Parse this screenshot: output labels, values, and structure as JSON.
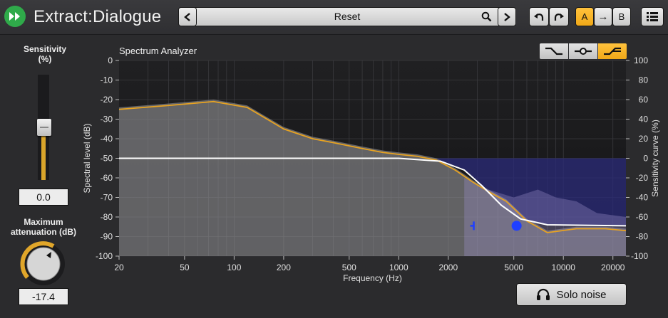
{
  "app": {
    "title": "Extract:Dialogue"
  },
  "preset": {
    "name": "Reset"
  },
  "ab": {
    "a_label": "A",
    "b_label": "B",
    "arrow": "→",
    "active": "A"
  },
  "sensitivity": {
    "label": "Sensitivity\n(%)",
    "value": "0.0",
    "level": 0.0
  },
  "attenuation": {
    "label": "Maximum\nattenuation (dB)",
    "value": "-17.4"
  },
  "analyzer": {
    "title": "Spectrum Analyzer"
  },
  "solo": {
    "label": "Solo noise"
  },
  "colors": {
    "accent": "#f0a818",
    "spectrum": "#e8a321",
    "curve": "#ffffff",
    "noise_region": "#2b2b7a",
    "handle": "#1f3fff"
  },
  "icons": {
    "logo": "fast-forward-icon",
    "preset_prev": "chevron-left-icon",
    "preset_search": "search-icon",
    "preset_next": "chevron-right-icon",
    "undo": "undo-icon",
    "redo": "redo-icon",
    "menu": "list-menu-icon",
    "headphones": "headphones-icon"
  },
  "chart_data": {
    "type": "line",
    "xlabel": "Frequency (Hz)",
    "ylabel": "Spectral level (dB)",
    "y2label": "Sensitivity curve (%)",
    "x_scale": "log",
    "xlim": [
      20,
      24000
    ],
    "ylim": [
      -100,
      0
    ],
    "y2lim": [
      -100,
      100
    ],
    "x_ticks": [
      "20",
      "50",
      "100",
      "200",
      "500",
      "1000",
      "2000",
      "5000",
      "10000",
      "20000"
    ],
    "y_ticks": [
      "0",
      "-10",
      "-20",
      "-30",
      "-40",
      "-50",
      "-60",
      "-70",
      "-80",
      "-90",
      "-100"
    ],
    "y2_ticks": [
      "100",
      "80",
      "60",
      "40",
      "20",
      "0",
      "-20",
      "-40",
      "-60",
      "-80",
      "-100"
    ],
    "series": [
      {
        "name": "",
        "points": [
          [
            20,
            -25
          ],
          [
            40,
            -23
          ],
          [
            75,
            -21
          ],
          [
            120,
            -24
          ],
          [
            200,
            -35
          ],
          [
            300,
            -40
          ],
          [
            400,
            -42
          ],
          [
            600,
            -45
          ],
          [
            800,
            -47
          ],
          [
            1000,
            -48
          ],
          [
            1300,
            -49
          ],
          [
            1700,
            -51
          ],
          [
            2200,
            -56
          ],
          [
            2800,
            -62
          ],
          [
            3500,
            -67
          ],
          [
            4500,
            -72
          ],
          [
            6000,
            -82
          ],
          [
            8000,
            -88
          ],
          [
            12000,
            -86
          ],
          [
            18000,
            -86
          ],
          [
            24000,
            -87
          ]
        ]
      },
      {
        "name": "",
        "points": [
          [
            20,
            0
          ],
          [
            1000,
            0
          ],
          [
            1800,
            -3
          ],
          [
            2500,
            -12
          ],
          [
            3200,
            -28
          ],
          [
            4200,
            -48
          ],
          [
            5500,
            -62
          ],
          [
            8000,
            -68
          ],
          [
            24000,
            -69
          ]
        ]
      }
    ],
    "markers": [
      {
        "x": 2800,
        "y2": -69,
        "shape": "bracket"
      },
      {
        "x": 5200,
        "y2": -69,
        "shape": "dot"
      }
    ]
  }
}
